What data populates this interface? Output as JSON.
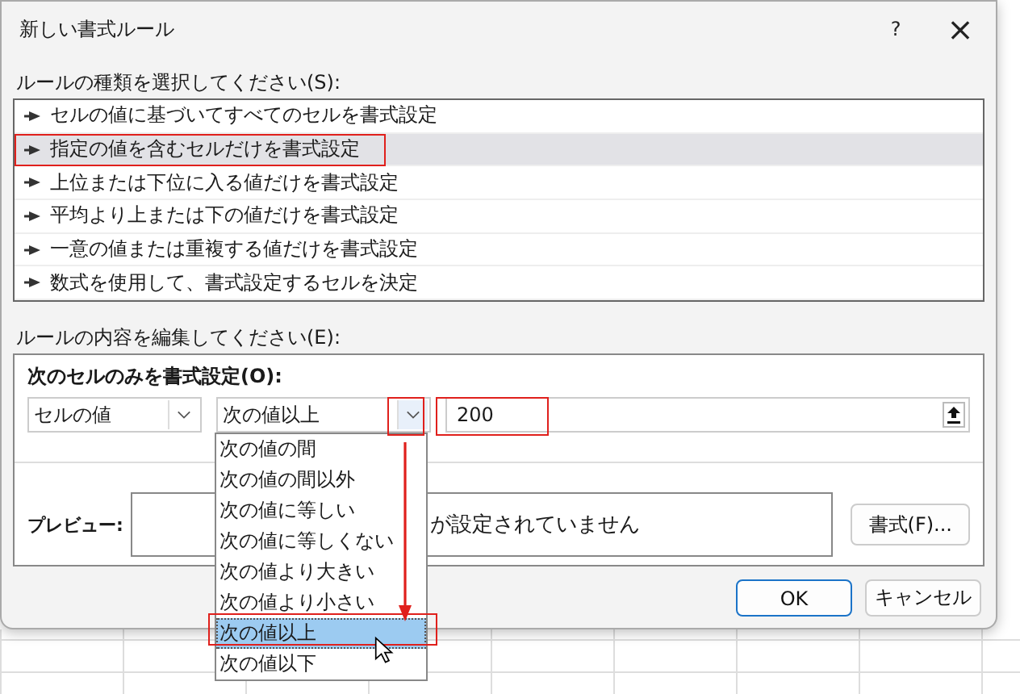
{
  "window": {
    "title": "新しい書式ルール",
    "help": "?",
    "close": "×"
  },
  "rule_type": {
    "label": "ルールの種類を選択してください(S):",
    "items": [
      {
        "label": "セルの値に基づいてすべてのセルを書式設定",
        "selected": false
      },
      {
        "label": "指定の値を含むセルだけを書式設定",
        "selected": true
      },
      {
        "label": "上位または下位に入る値だけを書式設定",
        "selected": false
      },
      {
        "label": "平均より上または下の値だけを書式設定",
        "selected": false
      },
      {
        "label": "一意の値または重複する値だけを書式設定",
        "selected": false
      },
      {
        "label": "数式を使用して、書式設定するセルを決定",
        "selected": false
      }
    ]
  },
  "edit": {
    "label": "ルールの内容を編集してください(E):",
    "heading": "次のセルのみを書式設定(O):",
    "subject": "セルの値",
    "operator": "次の値以上",
    "value": "200",
    "preview_label": "プレビュー:",
    "preview_text": "が設定されていません",
    "format_button": "書式(F)..."
  },
  "dropdown": {
    "items": [
      {
        "label": "次の値の間",
        "selected": false
      },
      {
        "label": "次の値の間以外",
        "selected": false
      },
      {
        "label": "次の値に等しい",
        "selected": false
      },
      {
        "label": "次の値に等しくない",
        "selected": false
      },
      {
        "label": "次の値より大きい",
        "selected": false
      },
      {
        "label": "次の値より小さい",
        "selected": false
      },
      {
        "label": "次の値以上",
        "selected": true
      },
      {
        "label": "次の値以下",
        "selected": false
      }
    ]
  },
  "buttons": [
    {
      "label": "OK",
      "default": true
    },
    {
      "label": "キャンセル",
      "default": false
    }
  ]
}
